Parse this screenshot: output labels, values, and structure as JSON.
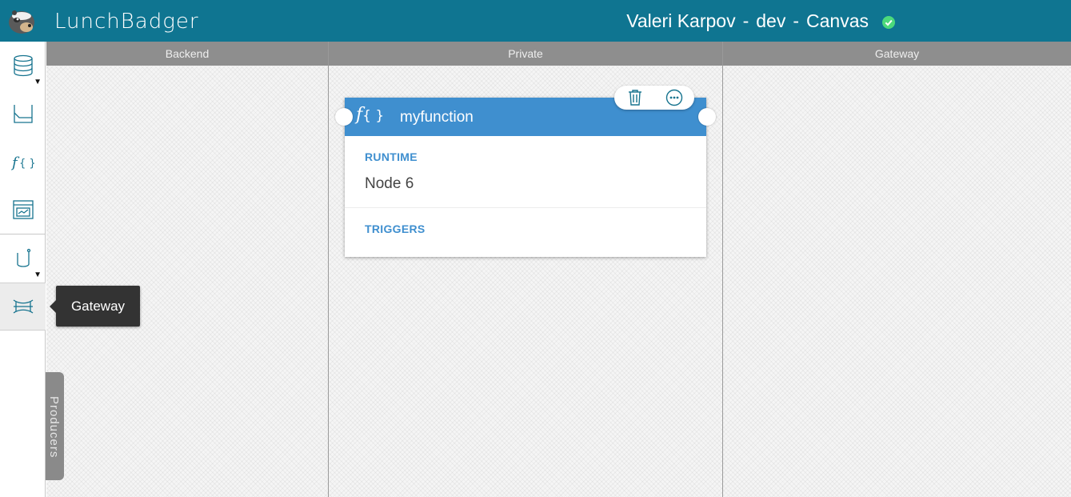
{
  "header": {
    "brand": "LunchBadger",
    "user": "Valeri Karpov",
    "sep1": "-",
    "env": "dev",
    "sep2": "-",
    "view": "Canvas",
    "status_color": "#4cd97b"
  },
  "sidebar": {
    "items": [
      {
        "icon": "database-icon",
        "has_menu": true
      },
      {
        "icon": "model-icon",
        "has_menu": false
      },
      {
        "icon": "function-icon",
        "has_menu": false
      },
      {
        "icon": "microservice-icon",
        "has_menu": false
      },
      {
        "icon": "api-endpoint-icon",
        "has_menu": true
      },
      {
        "icon": "gateway-icon",
        "has_menu": false,
        "active": true
      }
    ],
    "tooltip": "Gateway"
  },
  "producers_tab": "Producers",
  "columns": [
    "Backend",
    "Private",
    "Gateway"
  ],
  "function_card": {
    "icon_text": "f",
    "icon_braces": "{ }",
    "name": "myfunction",
    "runtime_label": "RUNTIME",
    "runtime_value": "Node 6",
    "triggers_label": "TRIGGERS",
    "toolbar": [
      "trash-icon",
      "more-icon"
    ]
  },
  "colors": {
    "header_bg": "#0f7591",
    "card_header": "#3f8fcf",
    "column_header": "#8e8e8e"
  }
}
